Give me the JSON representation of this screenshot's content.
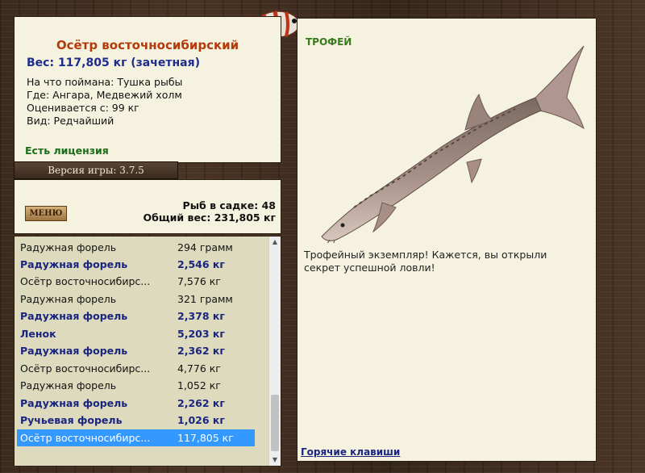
{
  "info": {
    "title": "Осётр восточносибирский",
    "weight": "Вес: 117,805 кг (зачетная)",
    "details": [
      "На что поймана: Тушка рыбы",
      "Где: Ангара, Медвежий холм",
      "Оценивается с: 99 кг",
      "Вид: Редчайший"
    ],
    "license": "Есть лицензия"
  },
  "version": "Версия игры: 3.7.5",
  "stats": {
    "menu_label": "МЕНЮ",
    "fish_count": "Рыб в садке: 48",
    "total_weight": "Общий вес: 231,805 кг"
  },
  "catch_list": [
    {
      "name": "Радужная форель",
      "weight": "294 грамм",
      "style": "norm"
    },
    {
      "name": "Радужная форель",
      "weight": "2,546 кг",
      "style": "bold"
    },
    {
      "name": "Осётр восточносибирс...",
      "weight": "7,576 кг",
      "style": "norm"
    },
    {
      "name": "Радужная форель",
      "weight": "321 грамм",
      "style": "norm"
    },
    {
      "name": "Радужная форель",
      "weight": "2,378 кг",
      "style": "bold"
    },
    {
      "name": "Ленок",
      "weight": "5,203 кг",
      "style": "bold"
    },
    {
      "name": "Радужная форель",
      "weight": "2,362 кг",
      "style": "bold"
    },
    {
      "name": "Осётр восточносибирс...",
      "weight": "4,776 кг",
      "style": "norm"
    },
    {
      "name": "Радужная форель",
      "weight": "1,052 кг",
      "style": "norm"
    },
    {
      "name": "Радужная форель",
      "weight": "2,262 кг",
      "style": "bold"
    },
    {
      "name": "Ручьевая форель",
      "weight": "1,026 кг",
      "style": "bold"
    },
    {
      "name": "Осётр восточносибирс...",
      "weight": "117,805 кг",
      "style": "sel"
    }
  ],
  "trophy": {
    "label": "ТРОФЕЙ",
    "text": "Трофейный экземпляр! Кажется, вы открыли секрет успешной ловли!",
    "hotkeys": "Горячие клавиши"
  },
  "colors": {
    "title": "#b43a0c",
    "weight": "#1e2d8c",
    "license": "#1a6e1a",
    "selected_row": "#3399ff",
    "trophy_label": "#3a7a1e"
  }
}
